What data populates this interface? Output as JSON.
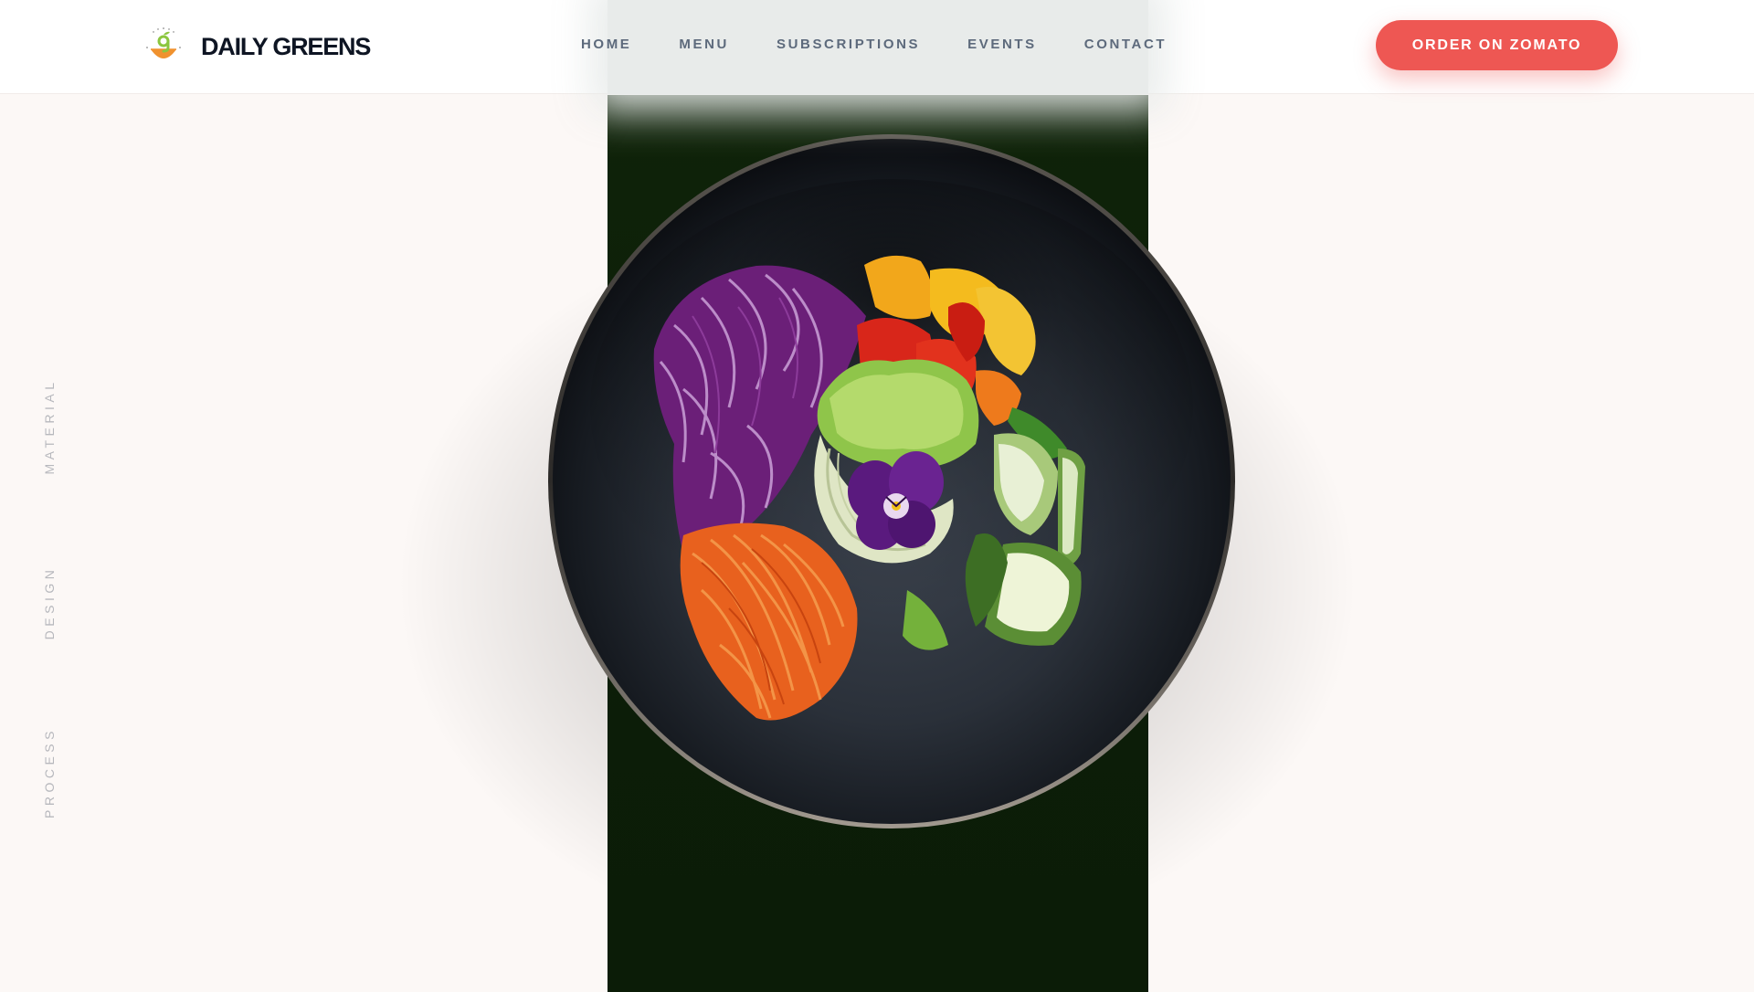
{
  "brand": {
    "name": "DAILY GREENS",
    "logo_icon": "bowl-sprout-icon",
    "logo_text": "DAILY GREENS",
    "accent_green": "#8cc63f",
    "accent_orange": "#f0922f"
  },
  "nav": {
    "items": [
      {
        "label": "HOME"
      },
      {
        "label": "MENU"
      },
      {
        "label": "SUBSCRIPTIONS"
      },
      {
        "label": "EVENTS"
      },
      {
        "label": "CONTACT"
      }
    ]
  },
  "cta": {
    "label": "ORDER ON ZOMATO",
    "color": "#ee5753"
  },
  "side_labels": [
    "MATERIAL",
    "DESIGN",
    "PROCESS"
  ],
  "hero": {
    "image": "salad-bowl-photo",
    "background": "#0f2309"
  }
}
